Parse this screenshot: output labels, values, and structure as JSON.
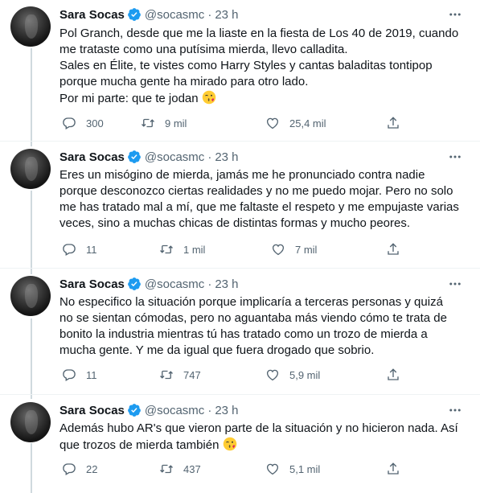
{
  "tweets": [
    {
      "name": "Sara Socas",
      "handle": "@socasmc",
      "dot": "·",
      "time": "23 h",
      "text": "Pol Granch, desde que me la liaste en la fiesta de Los 40 de 2019, cuando\nme trataste como una putísima mierda, llevo calladita.\nSales en Élite, te vistes como Harry Styles y cantas baladitas tontipop\nporque mucha gente ha mirado para otro lado.\nPor mi parte: que te jodan",
      "emoji": "face-blowing-kiss-icon",
      "replies": "300",
      "retweets": "9 mil",
      "likes": "25,4 mil"
    },
    {
      "name": "Sara Socas",
      "handle": "@socasmc",
      "dot": "·",
      "time": "23 h",
      "text": "Eres un misógino de mierda, jamás me he pronunciado contra nadie\nporque desconozco ciertas realidades y no me puedo mojar. Pero no solo\nme has tratado mal a mí, que me faltaste el respeto y me empujaste varias\nveces, sino a muchas chicas de distintas formas y mucho peores.",
      "replies": "11",
      "retweets": "1 mil",
      "likes": "7 mil"
    },
    {
      "name": "Sara Socas",
      "handle": "@socasmc",
      "dot": "·",
      "time": "23 h",
      "text": "No especifico la situación porque implicaría a terceras personas y quizá\nno se sientan cómodas, pero no aguantaba más viendo cómo te trata de\nbonito la industria mientras tú has tratado como un trozo de mierda a\nmucha gente. Y me da igual que fuera drogado que sobrio.",
      "replies": "11",
      "retweets": "747",
      "likes": "5,9 mil"
    },
    {
      "name": "Sara Socas",
      "handle": "@socasmc",
      "dot": "·",
      "time": "23 h",
      "text": "Además hubo AR's que vieron parte de la situación y no hicieron nada. Así\nque trozos de mierda también",
      "emoji": "face-blowing-kiss-icon",
      "replies": "22",
      "retweets": "437",
      "likes": "5,1 mil"
    }
  ],
  "colors": {
    "accent": "#1d9bf0",
    "secondary_text": "#536471",
    "thread_line": "#cfd9de"
  }
}
